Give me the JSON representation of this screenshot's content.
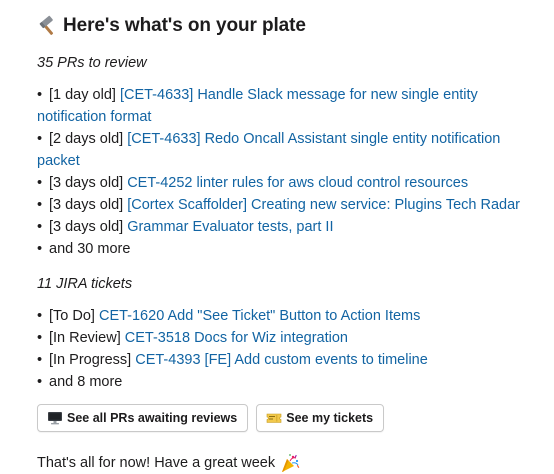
{
  "header": {
    "title": "Here's what's on your plate",
    "icon": "hammer-icon"
  },
  "prs": {
    "title": "35 PRs to review",
    "items": [
      {
        "age": "[1 day old]",
        "link": "[CET-4633] Handle Slack message for new single entity notification format"
      },
      {
        "age": "[2 days old]",
        "link": "[CET-4633] Redo Oncall Assistant single entity notification packet"
      },
      {
        "age": "[3 days old]",
        "link": "CET-4252 linter rules for aws cloud control resources"
      },
      {
        "age": "[3 days old]",
        "link": "[Cortex Scaffolder] Creating new service: Plugins Tech Radar"
      },
      {
        "age": "[3 days old]",
        "link": "Grammar Evaluator tests, part II"
      }
    ],
    "more": "and 30 more"
  },
  "jira": {
    "title": "11 JIRA tickets",
    "items": [
      {
        "status": "[To Do]",
        "link": "CET-1620 Add \"See Ticket\" Button to Action Items"
      },
      {
        "status": "[In Review]",
        "link": "CET-3518 Docs for Wiz integration"
      },
      {
        "status": "[In Progress]",
        "link": "CET-4393 [FE] Add custom events to timeline"
      }
    ],
    "more": "and 8 more"
  },
  "buttons": {
    "prs_label": "See all PRs awaiting reviews",
    "prs_icon": "desktop-computer-icon",
    "tickets_label": "See my tickets",
    "tickets_icon": "ticket-icon"
  },
  "footer": {
    "text": "That's all for now! Have a great week",
    "icon": "party-popper-icon"
  },
  "colors": {
    "link": "#1264a3",
    "text": "#1d1c1d"
  }
}
